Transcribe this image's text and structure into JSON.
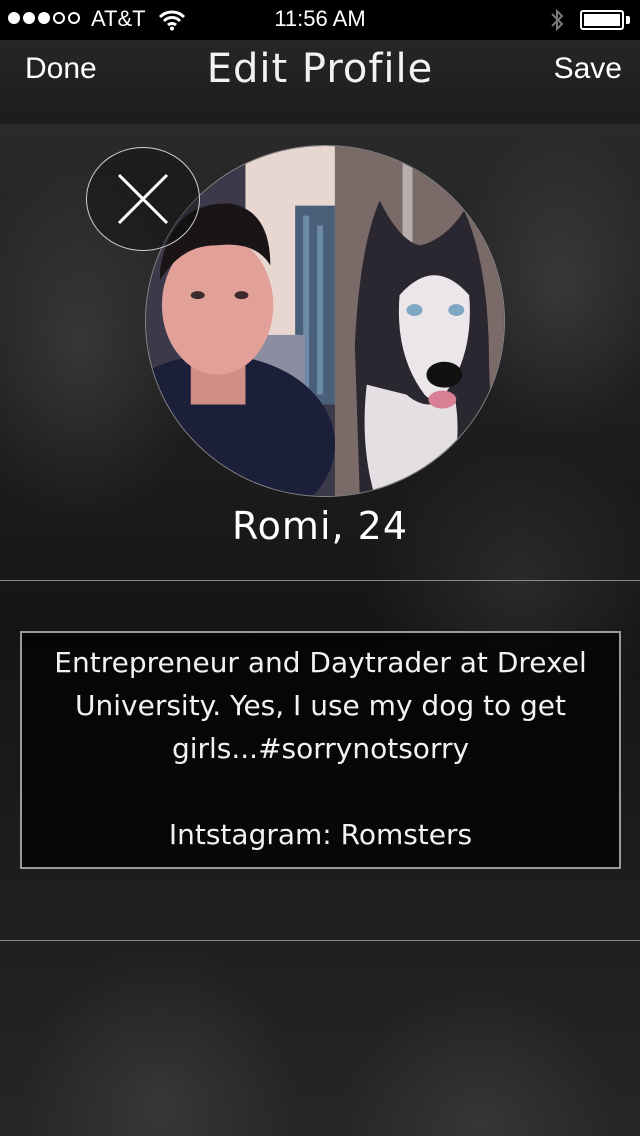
{
  "status_bar": {
    "carrier": "AT&T",
    "time": "11:56 AM",
    "signal_bars_filled": 3,
    "signal_bars_total": 5,
    "battery_level": 1.0,
    "icons": [
      "signal-dots-icon",
      "wifi-icon",
      "bluetooth-icon",
      "battery-icon"
    ]
  },
  "nav": {
    "done_label": "Done",
    "title": "Edit Profile",
    "save_label": "Save"
  },
  "profile": {
    "name_age": "Romi, 24",
    "remove_photo_icon": "close-icon",
    "bio_lines": [
      "Entrepreneur and Daytrader at Drexel",
      "University. Yes, I use my dog to get",
      "girls...#sorrynotsorry"
    ],
    "instagram_line": "Intstagram: Romsters"
  }
}
